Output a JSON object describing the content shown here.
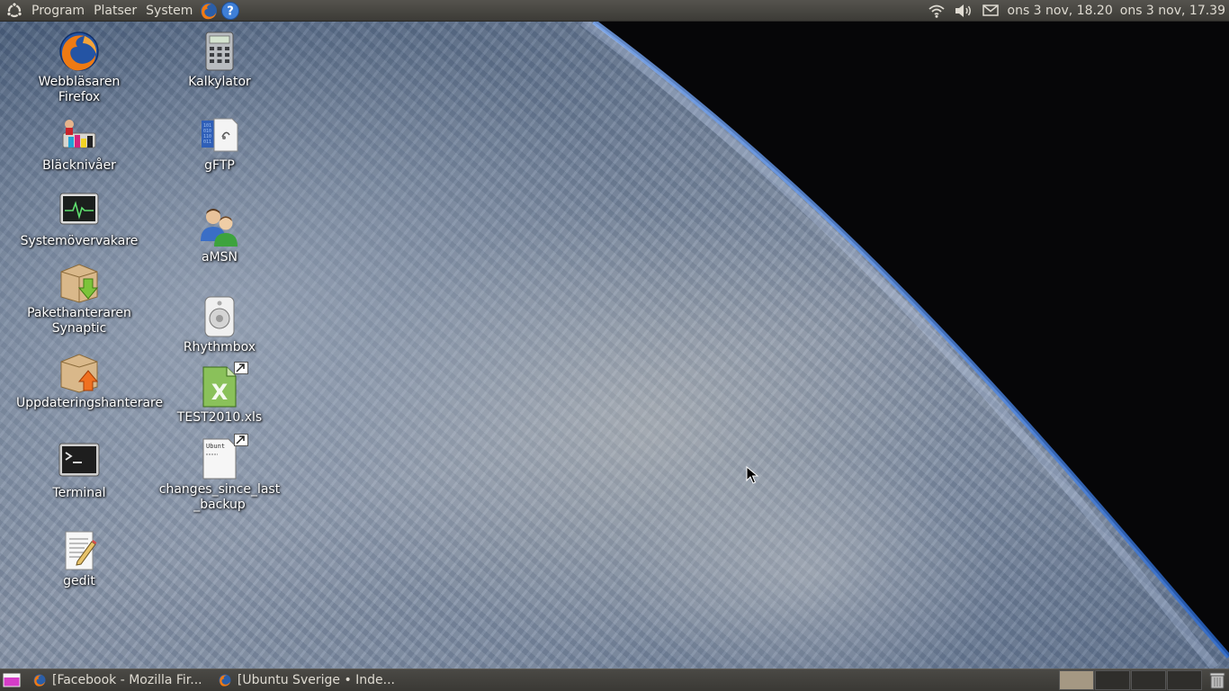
{
  "top_panel": {
    "menus": [
      "Program",
      "Platser",
      "System"
    ],
    "clock_1": "ons  3 nov, 18.20",
    "clock_2": "ons  3 nov, 17.39"
  },
  "desktop_icons": {
    "firefox": "Webbläsaren Firefox",
    "kalkylator": "Kalkylator",
    "blacknivaer": "Bläcknivåer",
    "gftp": "gFTP",
    "systemovervakare": "Systemövervakare",
    "amsn": "aMSN",
    "synaptic": "Pakethanteraren Synaptic",
    "rhythmbox": "Rhythmbox",
    "uppdatering": "Uppdateringshanterare",
    "test2010": "TEST2010.xls",
    "terminal": "Terminal",
    "changes": "changes_since_last_backup",
    "gedit": "gedit",
    "changes_thumb_text": "Ubunt"
  },
  "taskbar": {
    "items": [
      {
        "label": "[Facebook - Mozilla Fir..."
      },
      {
        "label": "[Ubuntu Sverige • Inde..."
      }
    ]
  },
  "colors": {
    "panel_bg": "#3c3b37",
    "panel_text": "#dfdbd2",
    "active_workspace": "#a59883"
  }
}
